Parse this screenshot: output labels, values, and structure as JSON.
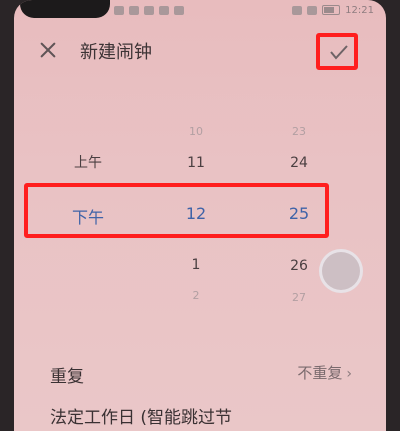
{
  "statusbar": {
    "time": "12:21"
  },
  "header": {
    "title": "新建闹钟"
  },
  "picker": {
    "period": {
      "above": "上午",
      "selected": "下午"
    },
    "hour": {
      "far_above": "10",
      "above": "11",
      "selected": "12",
      "below": "1",
      "far_below": "2"
    },
    "minute": {
      "far_above": "23",
      "above": "24",
      "selected": "25",
      "below": "26",
      "far_below": "27"
    }
  },
  "settings": {
    "repeat": {
      "label": "重复",
      "value": "不重复"
    },
    "holiday": {
      "label": "法定工作日 (智能跳过节"
    }
  },
  "colors": {
    "highlight": "#ff1e1e",
    "selected": "#3f63a8",
    "background": "#e9c2c4"
  }
}
